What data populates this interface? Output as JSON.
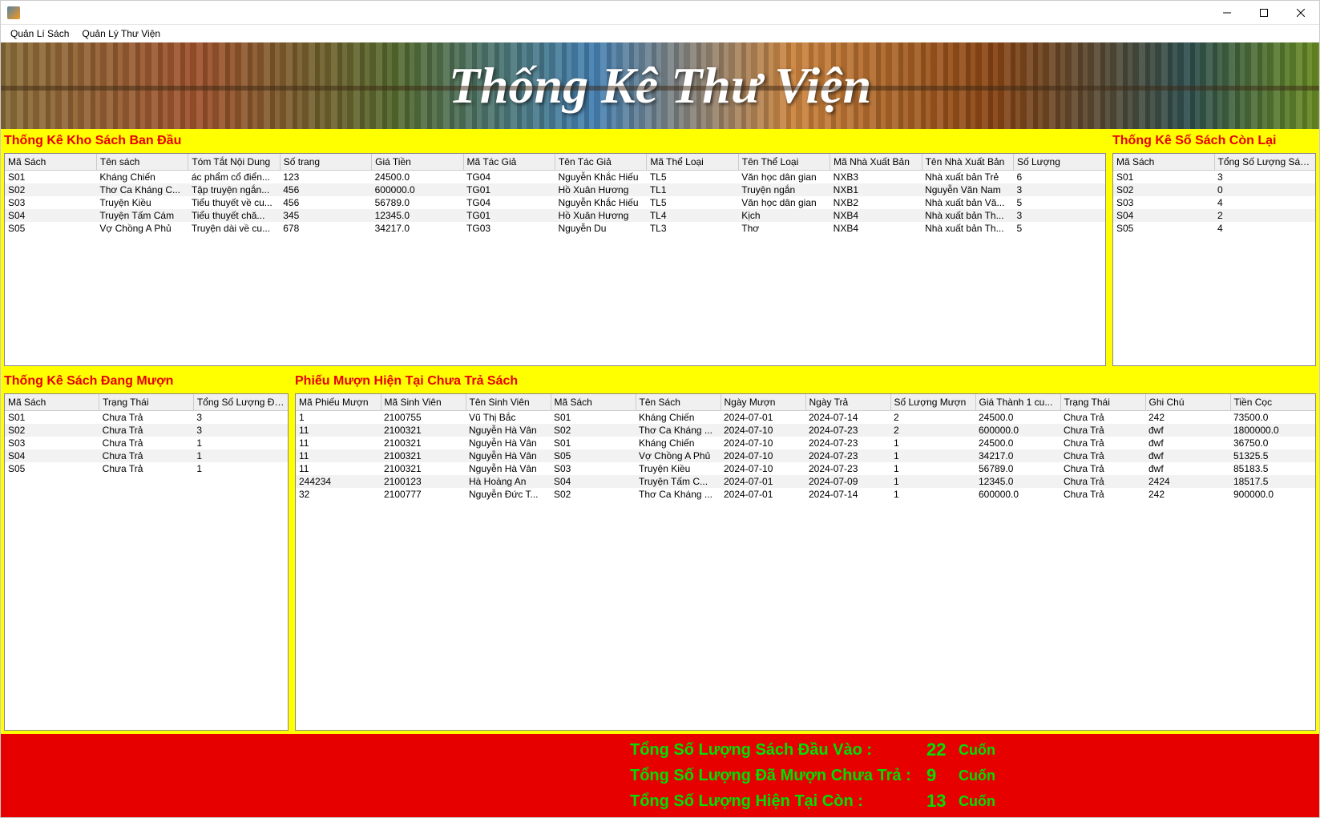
{
  "titlebar": {
    "title": ""
  },
  "menubar": {
    "items": [
      "Quản Lí Sách",
      "Quản Lý Thư Viện"
    ]
  },
  "banner": {
    "title": "Thống Kê Thư Viện"
  },
  "panels": {
    "kho": {
      "title": "Thống Kê Kho Sách Ban Đầu",
      "headers": [
        "Mã Sách",
        "Tên sách",
        "Tóm Tắt Nội Dung",
        "Số trang",
        "Giá Tiền",
        "Mã Tác Giả",
        "Tên Tác Giả",
        "Mã Thể Loại",
        "Tên Thể Loại",
        "Mã Nhà Xuất Bản",
        "Tên Nhà Xuất Bản",
        "Số Lượng"
      ],
      "rows": [
        [
          "S01",
          "Kháng Chiến",
          "ác phẩm cổ điển...",
          "123",
          "24500.0",
          "TG04",
          "Nguyễn Khắc Hiếu",
          "TL5",
          "Văn học dân gian",
          "NXB3",
          "Nhà xuất bản Trẻ",
          "6"
        ],
        [
          "S02",
          "Thơ Ca Kháng C...",
          "Tập truyện ngắn...",
          "456",
          "600000.0",
          "TG01",
          "Hồ Xuân Hương",
          "TL1",
          "Truyện ngắn",
          "NXB1",
          "Nguyễn Văn Nam",
          "3"
        ],
        [
          "S03",
          "Truyện Kiều",
          "Tiểu thuyết về cu...",
          "456",
          "56789.0",
          "TG04",
          "Nguyễn Khắc Hiếu",
          "TL5",
          "Văn học dân gian",
          "NXB2",
          "Nhà xuất bản Vă...",
          "5"
        ],
        [
          "S04",
          "Truyện Tấm Cám",
          "Tiểu thuyết chă...",
          "345",
          "12345.0",
          "TG01",
          "Hồ Xuân Hương",
          "TL4",
          "Kịch",
          "NXB4",
          "Nhà xuất bản Th...",
          "3"
        ],
        [
          "S05",
          "Vợ Chồng A Phủ",
          "Truyện dài về cu...",
          "678",
          "34217.0",
          "TG03",
          "Nguyễn Du",
          "TL3",
          "Thơ",
          "NXB4",
          "Nhà xuất bản Th...",
          "5"
        ]
      ]
    },
    "conlai": {
      "title": "Thống Kê Số Sách Còn Lại",
      "headers": [
        "Mã Sách",
        "Tổng Số Lượng Sách ..."
      ],
      "rows": [
        [
          "S01",
          "3"
        ],
        [
          "S02",
          "0"
        ],
        [
          "S03",
          "4"
        ],
        [
          "S04",
          "2"
        ],
        [
          "S05",
          "4"
        ]
      ]
    },
    "dangmuon": {
      "title": "Thống Kê Sách Đang Mượn",
      "headers": [
        "Mã Sách",
        "Trạng Thái",
        "Tổng Số Lượng Đan..."
      ],
      "rows": [
        [
          "S01",
          "Chưa Trả",
          "3"
        ],
        [
          "S02",
          "Chưa Trả",
          "3"
        ],
        [
          "S03",
          "Chưa Trả",
          "1"
        ],
        [
          "S04",
          "Chưa Trả",
          "1"
        ],
        [
          "S05",
          "Chưa Trả",
          "1"
        ]
      ]
    },
    "phieu": {
      "title": "Phiếu Mượn Hiện Tại Chưa Trả Sách",
      "headers": [
        "Mã Phiếu Mượn",
        "Mã Sinh Viên",
        "Tên Sinh Viên",
        "Mã Sách",
        "Tên Sách",
        "Ngày Mượn",
        "Ngày Trả",
        "Số Lượng Mượn",
        "Giá Thành 1 cu...",
        "Trạng Thái",
        "Ghi Chú",
        "Tiền Cọc"
      ],
      "rows": [
        [
          "1",
          "2100755",
          "Vũ Thị Bắc",
          "S01",
          "Kháng Chiến",
          "2024-07-01",
          "2024-07-14",
          "2",
          "24500.0",
          "Chưa Trả",
          "242",
          "73500.0"
        ],
        [
          "11",
          "2100321",
          "Nguyễn Hà Vân",
          "S02",
          "Thơ Ca Kháng ...",
          "2024-07-10",
          "2024-07-23",
          "2",
          "600000.0",
          "Chưa Trả",
          "đwf",
          "1800000.0"
        ],
        [
          "11",
          "2100321",
          "Nguyễn Hà Vân",
          "S01",
          "Kháng Chiến",
          "2024-07-10",
          "2024-07-23",
          "1",
          "24500.0",
          "Chưa Trả",
          "đwf",
          "36750.0"
        ],
        [
          "11",
          "2100321",
          "Nguyễn Hà Vân",
          "S05",
          "Vợ Chồng A Phủ",
          "2024-07-10",
          "2024-07-23",
          "1",
          "34217.0",
          "Chưa Trả",
          "đwf",
          "51325.5"
        ],
        [
          "11",
          "2100321",
          "Nguyễn Hà Vân",
          "S03",
          "Truyện Kiều",
          "2024-07-10",
          "2024-07-23",
          "1",
          "56789.0",
          "Chưa Trả",
          "đwf",
          "85183.5"
        ],
        [
          "244234",
          "2100123",
          "Hà Hoàng An",
          "S04",
          "Truyện Tấm C...",
          "2024-07-01",
          "2024-07-09",
          "1",
          "12345.0",
          "Chưa Trả",
          "2424",
          "18517.5"
        ],
        [
          "32",
          "2100777",
          "Nguyễn Đức T...",
          "S02",
          "Thơ Ca Kháng ...",
          "2024-07-01",
          "2024-07-14",
          "1",
          "600000.0",
          "Chưa Trả",
          "242",
          "900000.0"
        ]
      ]
    }
  },
  "footer": {
    "rows": [
      {
        "label": "Tổng Số Lượng Sách Đầu Vào :",
        "value": "22",
        "unit": "Cuốn"
      },
      {
        "label": "Tổng Số Lượng Đã Mượn Chưa Trả :",
        "value": "9",
        "unit": "Cuốn"
      },
      {
        "label": "Tổng Số Lượng Hiện  Tại Còn :",
        "value": "13",
        "unit": "Cuốn"
      }
    ]
  }
}
